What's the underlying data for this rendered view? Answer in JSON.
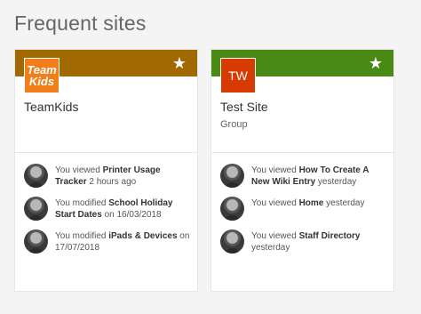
{
  "section": {
    "title": "Frequent sites"
  },
  "colors": {
    "teamkids_banner": "#a06a00",
    "testsite_banner": "#4a8a14",
    "tw_logo": "#d83b01",
    "teamkids_logo": "#f07f1b"
  },
  "cards": [
    {
      "name": "TeamKids",
      "subtitle": "",
      "logo_text": "Team Kids",
      "star_icon": "★",
      "activities": [
        {
          "prefix": "You viewed ",
          "item": "Printer Usage Tracker",
          "suffix": " 2 hours ago"
        },
        {
          "prefix": "You modified ",
          "item": "School Holiday Start Dates",
          "suffix": " on 16/03/2018"
        },
        {
          "prefix": "You modified ",
          "item": "iPads & Devices",
          "suffix": " on 17/07/2018"
        }
      ]
    },
    {
      "name": "Test Site",
      "subtitle": "Group",
      "logo_text": "TW",
      "star_icon": "★",
      "activities": [
        {
          "prefix": "You viewed ",
          "item": "How To Create A New Wiki Entry",
          "suffix": " yesterday"
        },
        {
          "prefix": "You viewed ",
          "item": "Home",
          "suffix": " yesterday"
        },
        {
          "prefix": "You viewed ",
          "item": "Staff Directory",
          "suffix": " yesterday"
        }
      ]
    }
  ]
}
